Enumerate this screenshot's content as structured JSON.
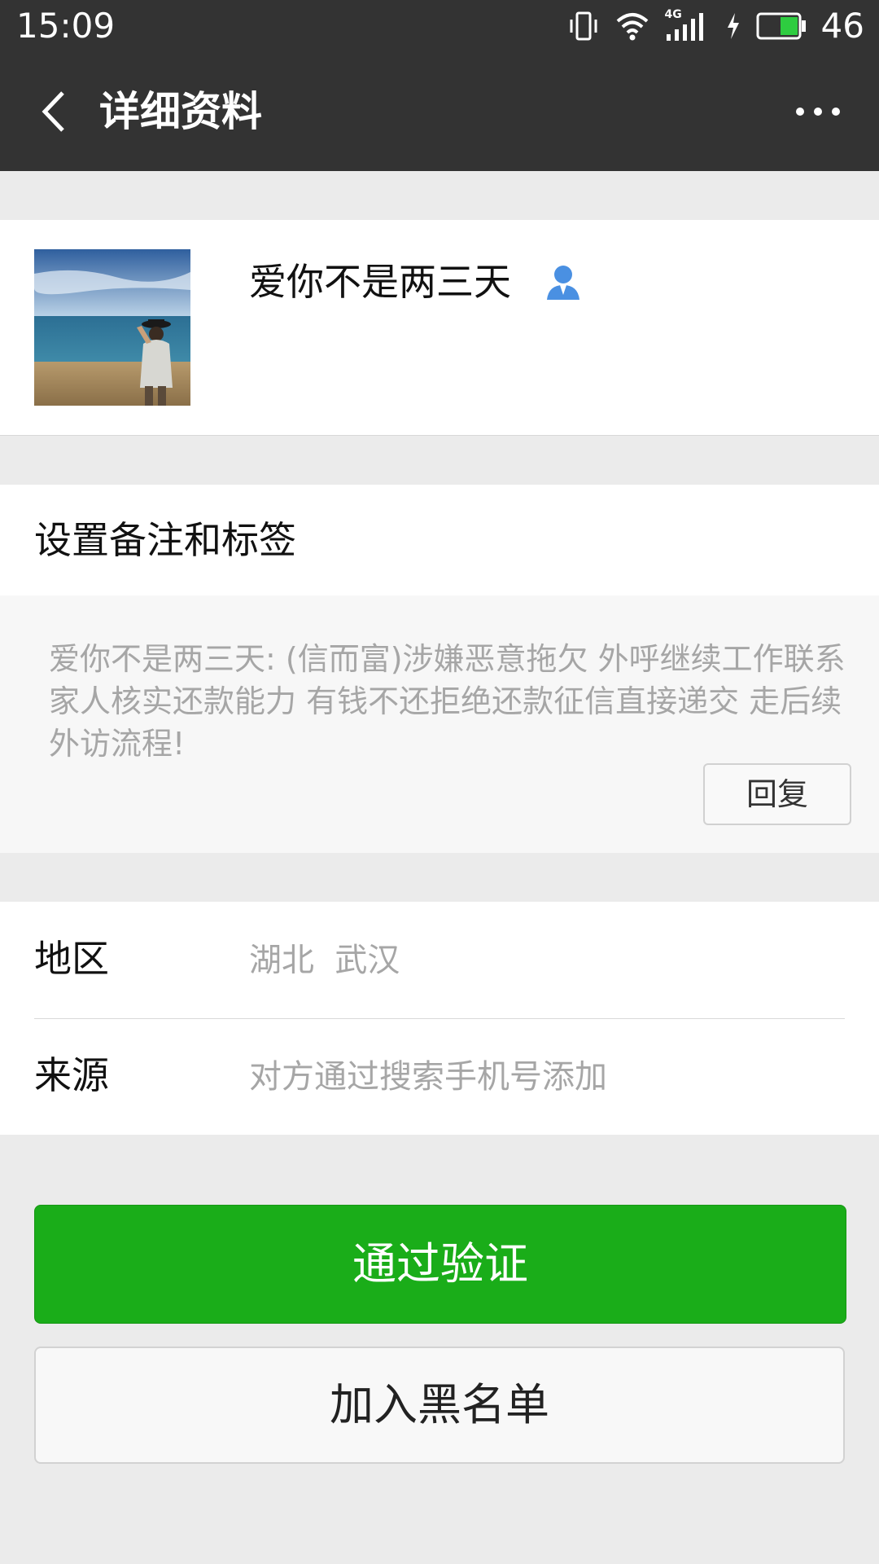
{
  "status_bar": {
    "time": "15:09",
    "network": "4G",
    "battery_level": "46",
    "icons": [
      "vibrate-icon",
      "wifi-icon",
      "signal-icon",
      "charging-icon",
      "battery-icon"
    ]
  },
  "header": {
    "title": "详细资料",
    "back_icon": "chevron-left-icon",
    "more_icon": "more-dots-icon"
  },
  "profile": {
    "nickname": "爱你不是两三天",
    "avatar": "beach-photo-avatar",
    "contact_icon": "contact-person-icon"
  },
  "remark": {
    "label": "设置备注和标签"
  },
  "message": {
    "text": "爱你不是两三天: (信而富)涉嫌恶意拖欠 外呼继续工作联系家人核实还款能力 有钱不还拒绝还款征信直接递交 走后续外访流程!",
    "reply_label": "回复"
  },
  "info": {
    "rows": [
      {
        "key": "地区",
        "value": "湖北  武汉"
      },
      {
        "key": "来源",
        "value": "对方通过搜索手机号添加"
      }
    ]
  },
  "actions": {
    "verify_label": "通过验证",
    "block_label": "加入黑名单"
  },
  "colors": {
    "topbar": "#333333",
    "accent_green": "#1aad19",
    "background": "#ebebeb",
    "secondary_text": "#a6a6a6"
  }
}
